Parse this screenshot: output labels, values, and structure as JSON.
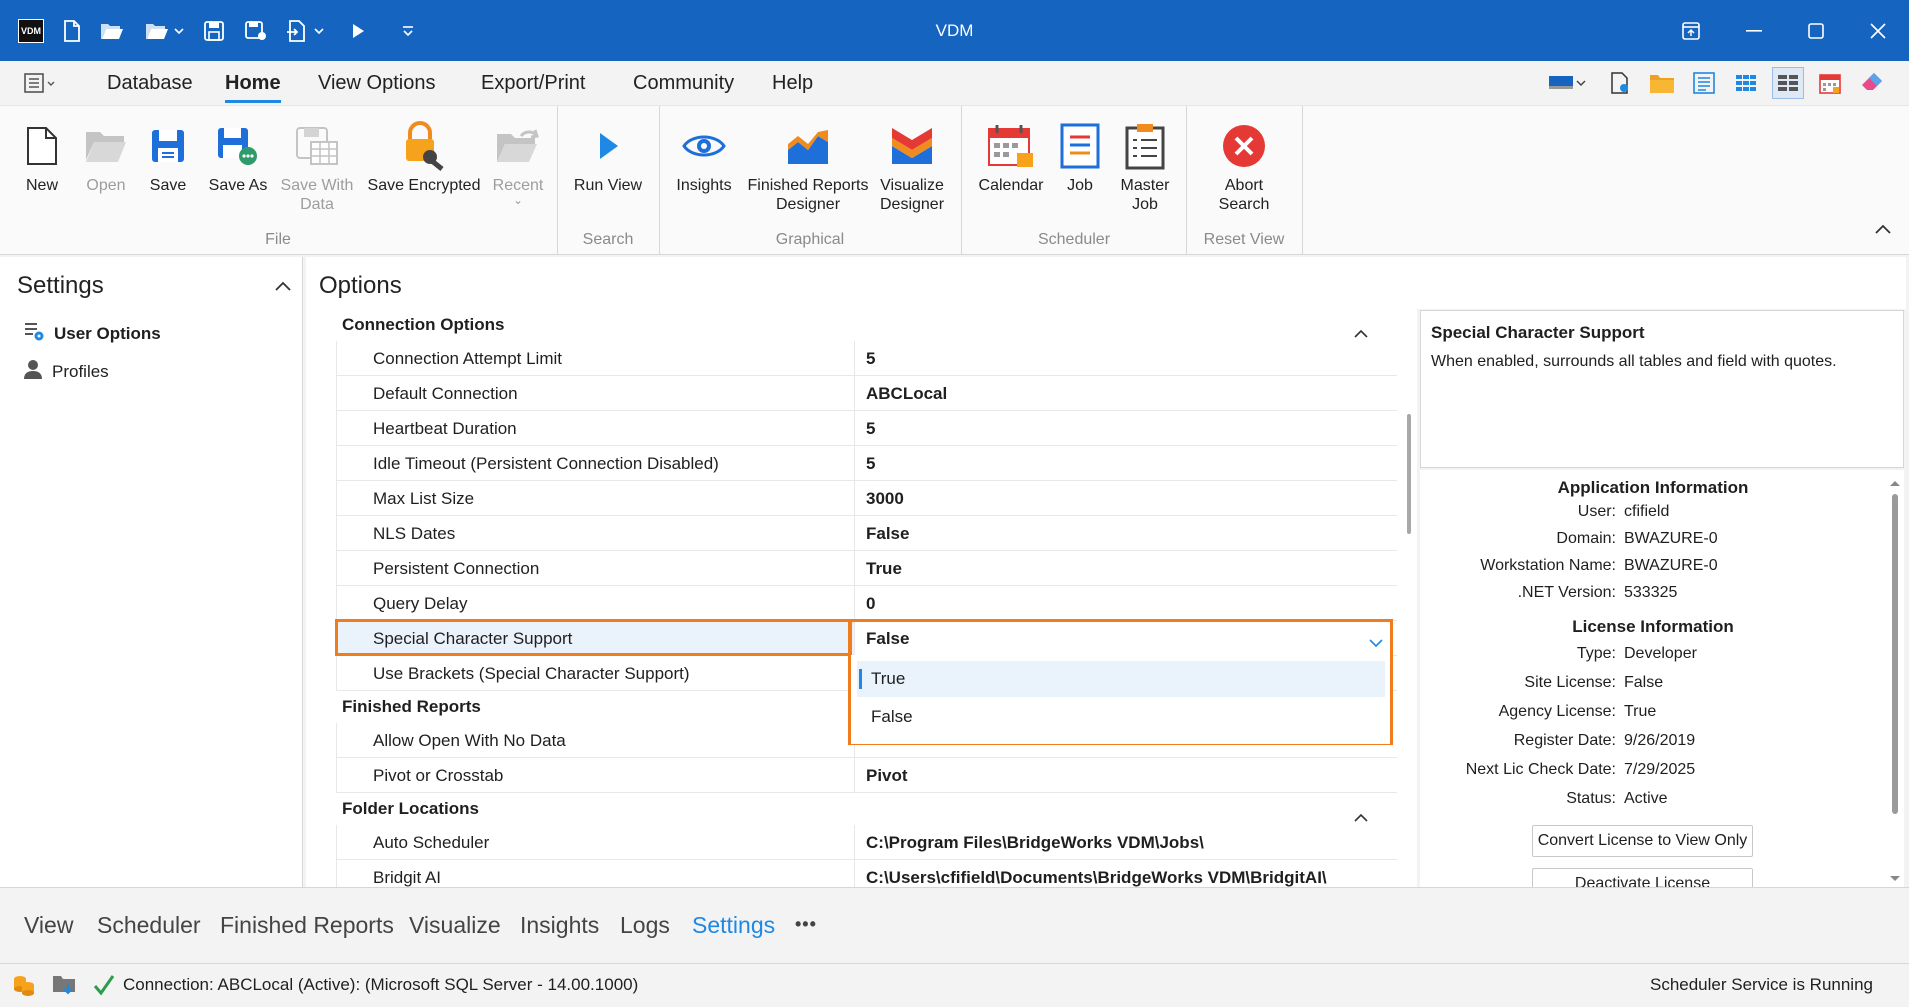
{
  "app": {
    "title": "VDM",
    "logo_text": "VDM"
  },
  "menu": {
    "tabs": [
      {
        "label": "Database"
      },
      {
        "label": "Home"
      },
      {
        "label": "View Options"
      },
      {
        "label": "Export/Print"
      },
      {
        "label": "Community"
      },
      {
        "label": "Help"
      }
    ],
    "active": "Home"
  },
  "ribbon": {
    "file": {
      "group": "File",
      "new": "New",
      "open": "Open",
      "save": "Save",
      "save_as": "Save As",
      "save_with_data_1": "Save With",
      "save_with_data_2": "Data",
      "save_encrypted": "Save Encrypted",
      "recent": "Recent"
    },
    "search": {
      "group": "Search",
      "run_view": "Run View"
    },
    "graphical": {
      "group": "Graphical",
      "insights": "Insights",
      "finished_1": "Finished Reports",
      "finished_2": "Designer",
      "visualize_1": "Visualize",
      "visualize_2": "Designer"
    },
    "scheduler": {
      "group": "Scheduler",
      "calendar": "Calendar",
      "job": "Job",
      "master_1": "Master",
      "master_2": "Job"
    },
    "reset": {
      "group": "Reset View",
      "abort_1": "Abort",
      "abort_2": "Search"
    }
  },
  "settings": {
    "title": "Settings",
    "items": [
      {
        "label": "User Options"
      },
      {
        "label": "Profiles"
      }
    ]
  },
  "options": {
    "title": "Options",
    "sections": [
      {
        "title": "Connection Options",
        "rows": [
          {
            "key": "Connection Attempt Limit",
            "value": "5"
          },
          {
            "key": "Default Connection",
            "value": "ABCLocal"
          },
          {
            "key": "Heartbeat Duration",
            "value": "5"
          },
          {
            "key": "Idle Timeout (Persistent Connection Disabled)",
            "value": "5"
          },
          {
            "key": "Max List Size",
            "value": "3000"
          },
          {
            "key": "NLS Dates",
            "value": "False"
          },
          {
            "key": "Persistent Connection",
            "value": "True"
          },
          {
            "key": "Query Delay",
            "value": "0"
          },
          {
            "key": "Special Character Support",
            "value": "False"
          },
          {
            "key": "Use Brackets (Special Character Support)",
            "value": ""
          }
        ]
      },
      {
        "title": "Finished Reports",
        "rows": [
          {
            "key": "Allow Open With No Data",
            "value": ""
          },
          {
            "key": "Pivot or Crosstab",
            "value": "Pivot"
          }
        ]
      },
      {
        "title": "Folder Locations",
        "rows": [
          {
            "key": "Auto Scheduler",
            "value": "C:\\Program Files\\BridgeWorks VDM\\Jobs\\"
          },
          {
            "key": "Bridgit AI",
            "value": "C:\\Users\\cfifield\\Documents\\BridgeWorks VDM\\BridgitAI\\"
          }
        ]
      }
    ],
    "dropdown": {
      "options": [
        "True",
        "False"
      ],
      "highlighted": "True"
    }
  },
  "description": {
    "title": "Special Character Support",
    "text": "When enabled, surrounds all tables and field with quotes."
  },
  "app_info": {
    "title": "Application Information",
    "rows": [
      {
        "label": "User:",
        "value": "cfifield"
      },
      {
        "label": "Domain:",
        "value": "BWAZURE-0"
      },
      {
        "label": "Workstation Name:",
        "value": "BWAZURE-0"
      },
      {
        "label": ".NET Version:",
        "value": "533325"
      }
    ]
  },
  "license_info": {
    "title": "License Information",
    "rows": [
      {
        "label": "Type:",
        "value": "Developer"
      },
      {
        "label": "Site License:",
        "value": "False"
      },
      {
        "label": "Agency License:",
        "value": "True"
      },
      {
        "label": "Register Date:",
        "value": "9/26/2019"
      },
      {
        "label": "Next Lic Check Date:",
        "value": "7/29/2025"
      },
      {
        "label": "Status:",
        "value": "Active"
      }
    ],
    "convert_button": "Convert License to View Only",
    "deactivate_button": "Deactivate License"
  },
  "bottom_tabs": {
    "items": [
      "View",
      "Scheduler",
      "Finished Reports",
      "Visualize",
      "Insights",
      "Logs",
      "Settings"
    ],
    "active": "Settings",
    "more": "•••"
  },
  "status": {
    "connection": "Connection: ABCLocal (Active): (Microsoft SQL Server - 14.00.1000)",
    "service": "Scheduler Service is Running"
  },
  "colors": {
    "accent": "#1e88e5",
    "titlebar": "#1565c0",
    "highlight": "#f07c1e"
  }
}
